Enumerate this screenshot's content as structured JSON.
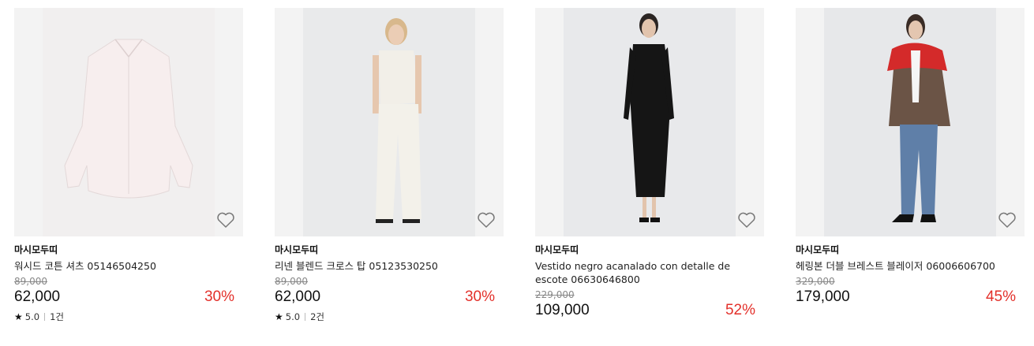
{
  "products": [
    {
      "brand": "마시모두띠",
      "name": "워시드 코튼 셔츠 05146504250",
      "original_price": "89,000",
      "price": "62,000",
      "discount": "30%",
      "rating": "5.0",
      "review_count": "1건",
      "wishlist_icon": "heart-outline-icon"
    },
    {
      "brand": "마시모두띠",
      "name": "리넨 블렌드 크로스 탑 05123530250",
      "original_price": "89,000",
      "price": "62,000",
      "discount": "30%",
      "rating": "5.0",
      "review_count": "2건",
      "wishlist_icon": "heart-outline-icon"
    },
    {
      "brand": "마시모두띠",
      "name": "Vestido negro acanalado con detalle de escote 06630646800",
      "original_price": "229,000",
      "price": "109,000",
      "discount": "52%",
      "wishlist_icon": "heart-outline-icon"
    },
    {
      "brand": "마시모두띠",
      "name": "헤링본 더블 브레스트 블레이저 06006606700",
      "original_price": "329,000",
      "price": "179,000",
      "discount": "45%",
      "wishlist_icon": "heart-outline-icon"
    }
  ],
  "colors": {
    "discount": "#e3302a",
    "strikethrough": "#888888",
    "image_bg": "#f3f3f3"
  }
}
